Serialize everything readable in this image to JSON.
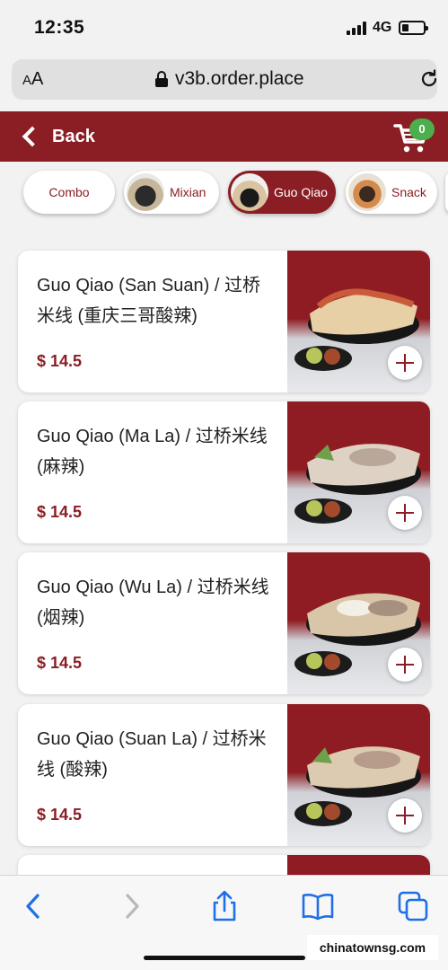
{
  "status_bar": {
    "time": "12:35",
    "network": "4G",
    "battery_level": 0.3
  },
  "browser": {
    "text_size_label": "AA",
    "url": "v3b.order.place"
  },
  "header": {
    "back_label": "Back",
    "cart_count": "0",
    "brand_color": "#8b1e24",
    "badge_color": "#4cae4c"
  },
  "categories": [
    {
      "label": "Combo",
      "active": false
    },
    {
      "label": "Mixian",
      "active": false
    },
    {
      "label": "Guo Qiao",
      "active": true
    },
    {
      "label": "Snack",
      "active": false
    }
  ],
  "products": [
    {
      "name": "Guo Qiao (San Suan) / 过桥米线 (重庆三哥酸辣)",
      "price": "$ 14.5"
    },
    {
      "name": "Guo Qiao (Ma La) / 过桥米线 (麻辣)",
      "price": "$ 14.5"
    },
    {
      "name": "Guo Qiao (Wu La) / 过桥米线 (烟辣)",
      "price": "$ 14.5"
    },
    {
      "name": "Guo Qiao (Suan La) / 过桥米线 (酸辣)",
      "price": "$ 14.5"
    }
  ],
  "toolbar_icons": [
    "back-icon",
    "forward-icon",
    "share-icon",
    "bookmarks-icon",
    "tabs-icon"
  ],
  "watermark": "chinatownsg.com"
}
